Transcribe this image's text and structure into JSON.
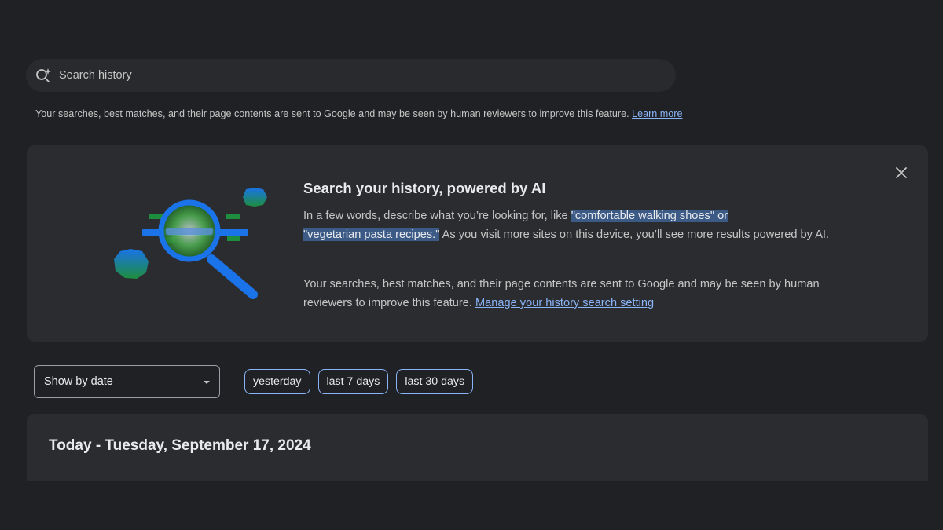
{
  "search": {
    "placeholder": "Search history",
    "icon": "sparkle-search-icon"
  },
  "disclaimer": {
    "text": "Your searches, best matches, and their page contents are sent to Google and may be seen by human reviewers to improve this feature. ",
    "link": "Learn more"
  },
  "promo": {
    "title": "Search your history, powered by AI",
    "p1_before": "In a few words, describe what you’re looking for, like ",
    "p1_highlight1": "\"comfortable walking shoes\" or",
    "p1_highlight2": "\"vegetarian pasta recipes.\"",
    "p1_after": " As you visit more sites on this device, you’ll see more results powered by AI.",
    "p2_text": "Your searches, best matches, and their page contents are sent to Google and may be seen by human reviewers to improve this feature. ",
    "p2_link": "Manage your history search setting",
    "close_icon": "close-icon",
    "illustration": "magnifier-illustration"
  },
  "filters": {
    "select_value": "Show by date",
    "chips": [
      "yesterday",
      "last 7 days",
      "last 30 days"
    ]
  },
  "history": {
    "day_title": "Today - Tuesday, September 17, 2024"
  },
  "colors": {
    "background": "#202124",
    "card": "#2b2c2f",
    "accent": "#8ab4f8",
    "highlight": "#3c5a86"
  }
}
